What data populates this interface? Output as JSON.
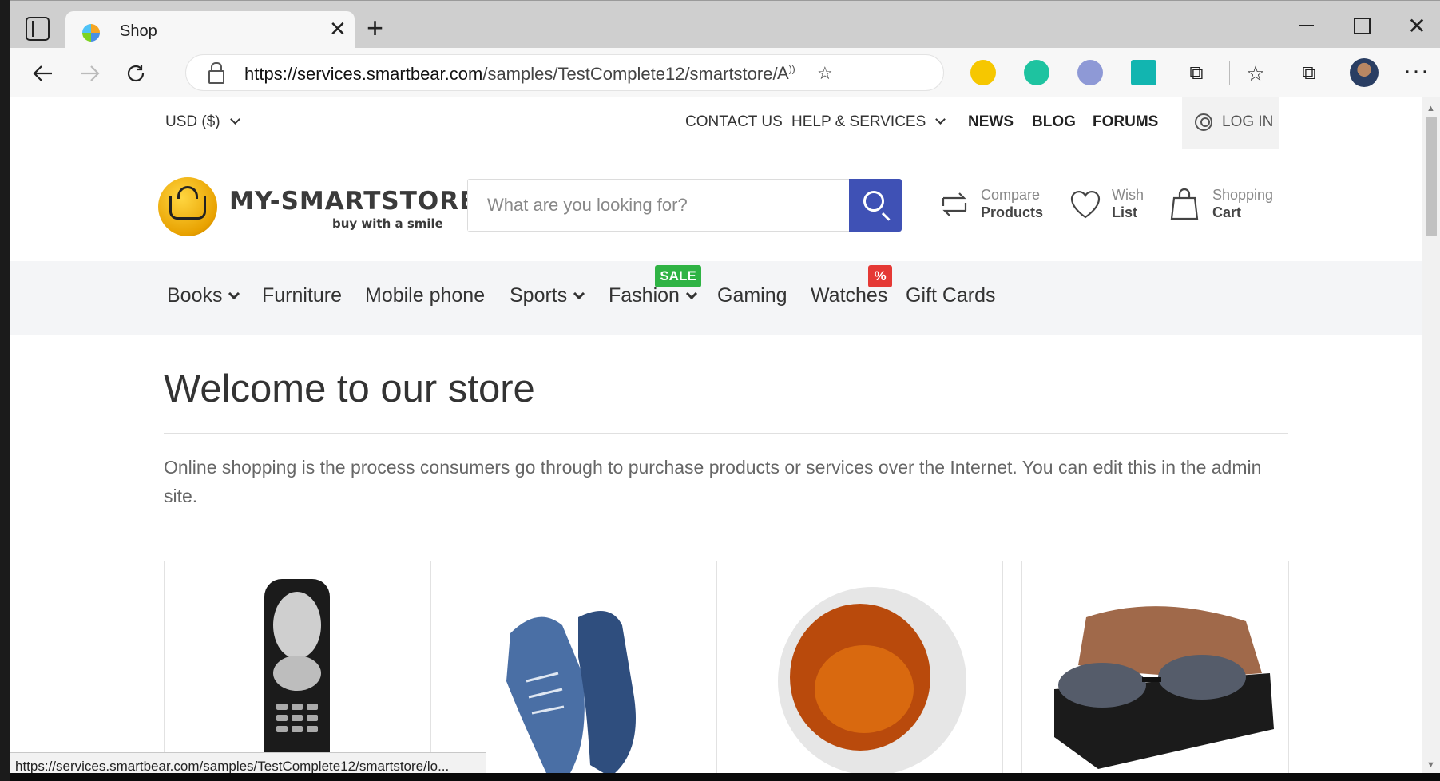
{
  "browser": {
    "tab_title": "Shop",
    "new_tab_symbol": "+",
    "close_symbol": "✕",
    "url_host": "https://services.smartbear.com",
    "url_path": "/samples/TestComplete12/smartstore/",
    "status_url": "https://services.smartbear.com/samples/TestComplete12/smartstore/lo..."
  },
  "topbar": {
    "currency": "USD  ($)",
    "contact": "CONTACT US",
    "help": "HELP & SERVICES",
    "news": "NEWS",
    "blog": "BLOG",
    "forums": "FORUMS",
    "login": "LOG IN"
  },
  "header": {
    "logo_name": "MY-SMARTSTORE",
    "logo_tagline": "buy with a smile",
    "search_placeholder": "What are you looking for?",
    "compare_l1": "Compare",
    "compare_l2": "Products",
    "wish_l1": "Wish",
    "wish_l2": "List",
    "cart_l1": "Shopping",
    "cart_l2": "Cart"
  },
  "nav": {
    "items": [
      "Books",
      "Furniture",
      "Mobile phone",
      "Sports",
      "Fashion",
      "Gaming",
      "Watches",
      "Gift Cards"
    ],
    "sale_badge": "SALE",
    "percent_badge": "%"
  },
  "content": {
    "welcome": "Welcome to our store",
    "intro": "Online shopping is the process consumers go through to purchase products or services over the Internet. You can edit this in the admin site."
  },
  "colors": {
    "search_button": "#3f51b5",
    "sale_badge": "#2fb344",
    "percent_badge": "#e53935"
  }
}
